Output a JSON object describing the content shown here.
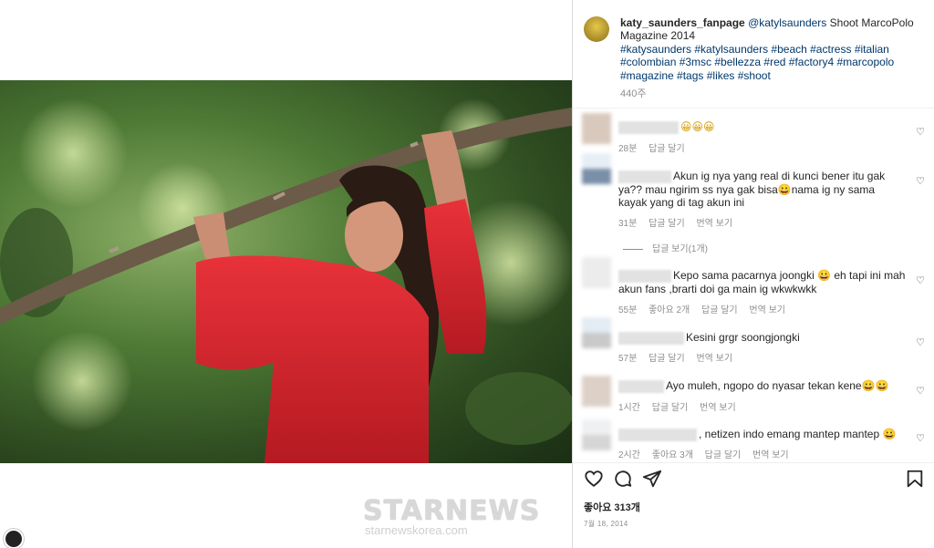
{
  "post": {
    "username": "katy_saunders_fanpage",
    "caption_mention": "@katylsaunders",
    "caption_text": " Shoot MarcoPolo Magazine 2014",
    "hashtags": "#katysaunders #katylsaunders #beach #actress #italian #colombian #3msc #bellezza #red #factory4 #marcopolo #magazine #tags #likes #shoot",
    "time": "440주"
  },
  "watermark": {
    "logo": "STARNEWS",
    "url": "starnewskorea.com"
  },
  "comments": [
    {
      "text": "😀😀😀",
      "time": "28분",
      "reply": "답글 달기",
      "likes": "",
      "translate": ""
    },
    {
      "text": "Akun ig nya yang real di kunci bener itu gak ya?? mau ngirim ss nya gak bisa😀nama ig ny sama kayak yang di tag akun ini",
      "time": "31분",
      "reply": "답글 달기",
      "likes": "",
      "translate": "번역 보기",
      "view_replies": "답글 보기(1개)"
    },
    {
      "text": "Kepo sama pacarnya joongki 😀 eh tapi ini mah akun fans ,brarti doi ga main ig wkwkwkk",
      "time": "55분",
      "reply": "답글 달기",
      "likes": "좋아요 2개",
      "translate": "번역 보기"
    },
    {
      "text": "Kesini grgr soongjongki",
      "time": "57분",
      "reply": "답글 달기",
      "likes": "",
      "translate": "번역 보기"
    },
    {
      "text": "Ayo muleh, ngopo do nyasar tekan kene😀😀",
      "time": "1시간",
      "reply": "답글 달기",
      "likes": "",
      "translate": "번역 보기"
    },
    {
      "text": ", netizen indo emang mantep mantep 😀",
      "time": "2시간",
      "reply": "답글 달기",
      "likes": "좋아요 3개",
      "translate": "번역 보기"
    }
  ],
  "footer": {
    "likes": "좋아요 313개",
    "date": "7월 18, 2014"
  },
  "icons": {
    "like": "heart-icon",
    "comment": "comment-icon",
    "share": "send-icon",
    "save": "bookmark-icon"
  }
}
